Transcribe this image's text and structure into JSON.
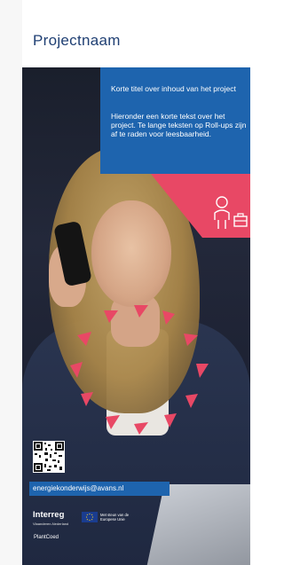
{
  "title": "Projectnaam",
  "info": {
    "short_title": "Korte titel over inhoud van het project",
    "body": "Hieronder een korte tekst over het project. Te lange teksten op Roll-ups zijn af te raden voor leesbaarheid."
  },
  "contact": {
    "email": "energiekonderwijs@avans.nl"
  },
  "logos": {
    "interreg": "Interreg",
    "interreg_sub": "Vlaanderen-Nederland",
    "eu_text": "Met steun van de Europese Unie",
    "plantcoed": "PlantCoed"
  },
  "colors": {
    "title": "#1f3f73",
    "blue": "#1e64ae",
    "pink": "#e84865"
  },
  "icons": [
    "person-with-briefcase-icon",
    "qr-code",
    "eu-flag-icon"
  ]
}
